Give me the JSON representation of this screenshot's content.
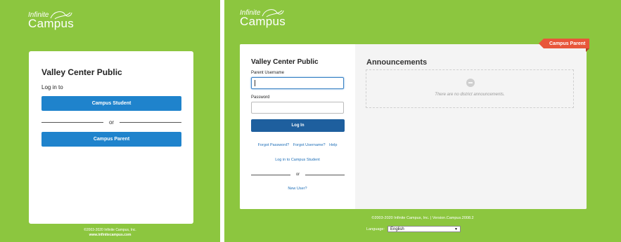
{
  "left": {
    "logo": {
      "line1": "Infinite",
      "line2": "Campus"
    },
    "school_name": "Valley Center Public",
    "login_prompt": "Log in to",
    "student_button": "Campus Student",
    "or_text": "or",
    "parent_button": "Campus Parent",
    "footer": {
      "copyright": "©2003-2020 Infinite Campus, Inc.",
      "website": "www.infinitecampus.com"
    }
  },
  "right": {
    "logo": {
      "line1": "Infinite",
      "line2": "Campus"
    },
    "ribbon": "Campus Parent",
    "school_name": "Valley Center Public",
    "username_label": "Parent Username",
    "username_value": "",
    "password_label": "Password",
    "password_value": "",
    "login_button": "Log In",
    "links": {
      "forgot_password": "Forgot Password?",
      "forgot_username": "Forgot Username?",
      "help": "Help"
    },
    "student_link": "Log in to Campus Student",
    "or_text": "or",
    "new_user": "New User?",
    "announcements": {
      "title": "Announcements",
      "empty_message": "There are no district announcements.",
      "empty_icon": "no-entry-icon"
    },
    "footer": "©2003-2020 Infinite Campus, Inc. | Version.Campus.2008.2",
    "language": {
      "label": "Language:",
      "selected": "English"
    }
  },
  "colors": {
    "background_green": "#8cc63f",
    "button_blue": "#1f83cc",
    "login_blue": "#1e5f9e",
    "ribbon_orange": "#e8563a",
    "link_blue": "#1f6fb8"
  }
}
